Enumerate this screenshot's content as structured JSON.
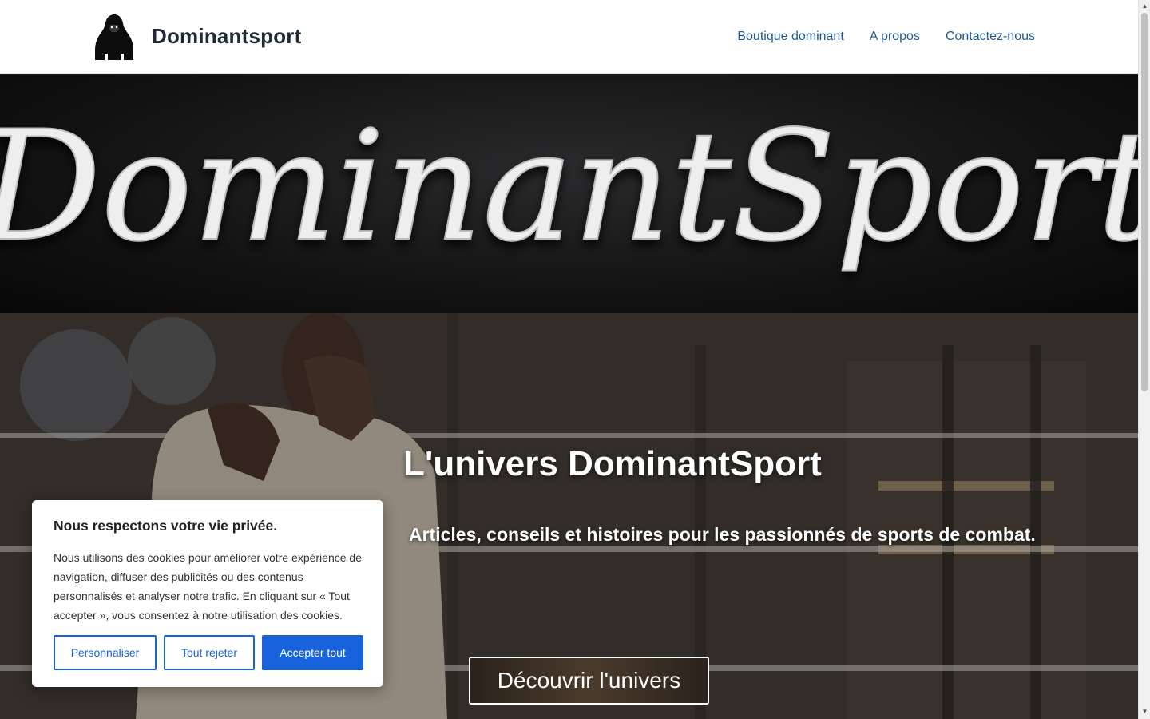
{
  "header": {
    "site_title": "Dominantsport",
    "logo_icon": "gorilla-icon",
    "nav": [
      {
        "label": "Boutique dominant"
      },
      {
        "label": "A propos"
      },
      {
        "label": "Contactez-nous"
      }
    ]
  },
  "banner": {
    "script_text": "DominantSport"
  },
  "hero": {
    "title": "L'univers DominantSport",
    "subtitle": "Articles, conseils et histoires pour les passionnés de sports de combat.",
    "cta_label": "Découvrir l'univers"
  },
  "cookie": {
    "title": "Nous respectons votre vie privée.",
    "text": "Nous utilisons des cookies pour améliorer votre expérience de navigation, diffuser des publicités ou des contenus personnalisés et analyser notre trafic. En cliquant sur « Tout accepter », vous consentez à notre utilisation des cookies.",
    "buttons": {
      "customize": "Personnaliser",
      "reject": "Tout rejeter",
      "accept": "Accepter tout"
    }
  },
  "colors": {
    "nav_link": "#1e5a96",
    "cookie_accent": "#1863dc",
    "title_text": "#1f2a36"
  }
}
